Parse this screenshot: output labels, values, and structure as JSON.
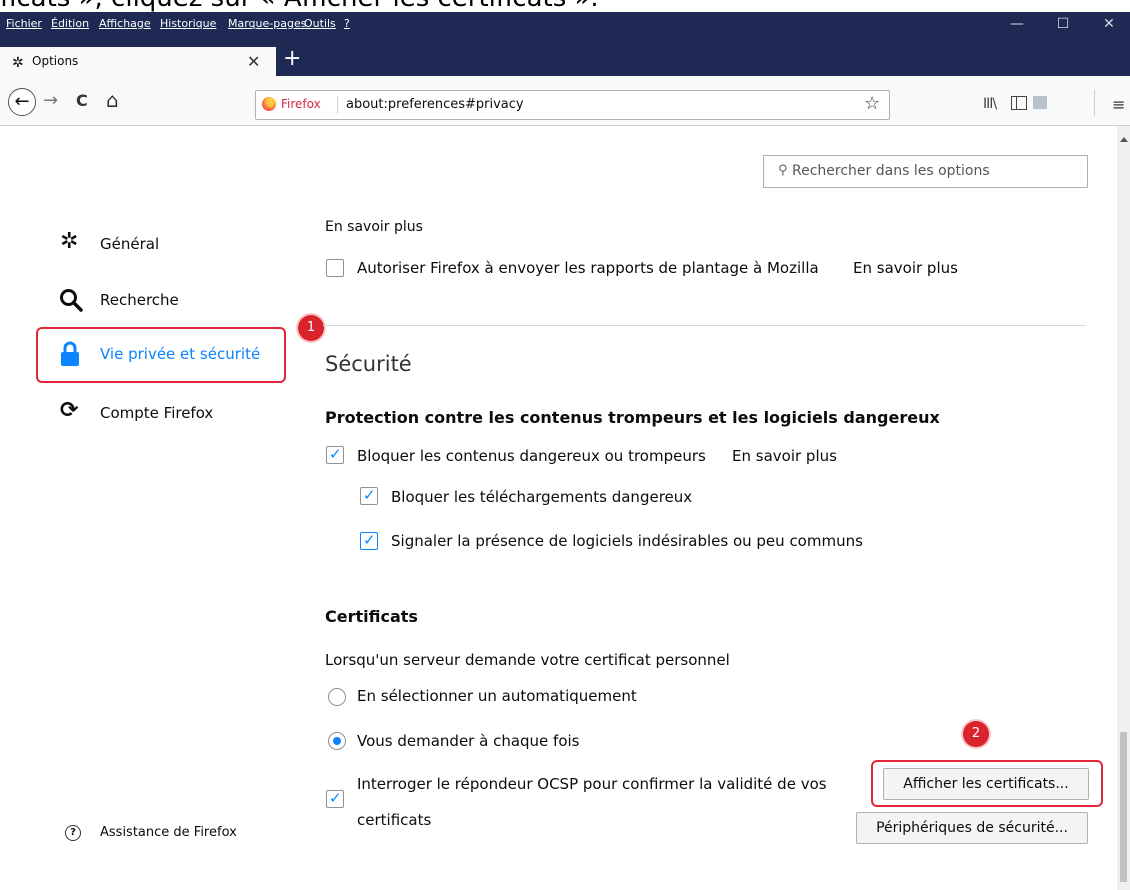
{
  "caption": "ficats », cliquez sur « Afficher les certificats ».",
  "menubar": {
    "items": [
      "Fichier",
      "Édition",
      "Affichage",
      "Historique",
      "Marque-pages",
      "Outils",
      "?"
    ],
    "minimize": "—",
    "maximize": "☐",
    "close": "✕"
  },
  "tab": {
    "title": "Options",
    "close": "✕",
    "new_tab": "+"
  },
  "navbar": {
    "back": "←",
    "forward": "→",
    "reload": "C",
    "home": "⌂",
    "brand": "Firefox",
    "url": "about:preferences#privacy",
    "star": "☆",
    "library": "III\\",
    "menu": "≡"
  },
  "search": {
    "placeholder": "Rechercher dans les options",
    "icon": "search-icon"
  },
  "sidebar": {
    "items": [
      {
        "label": "Général",
        "icon": "gear-icon"
      },
      {
        "label": "Recherche",
        "icon": "search-icon"
      },
      {
        "label": "Vie privée et sécurité",
        "icon": "lock-icon",
        "active": true
      },
      {
        "label": "Compte Firefox",
        "icon": "sync-icon"
      }
    ],
    "support": "Assistance de Firefox"
  },
  "badges": {
    "first": "1",
    "second": "2"
  },
  "content": {
    "top_link": "En savoir plus",
    "crash_reports": {
      "label": "Autoriser Firefox à envoyer les rapports de plantage à Mozilla",
      "link": "En savoir plus",
      "checked": false
    },
    "security_heading": "Sécurité",
    "protection_heading": "Protection contre les contenus trompeurs et les logiciels dangereux",
    "block_dangerous": {
      "label": "Bloquer les contenus dangereux ou trompeurs",
      "link": "En savoir plus",
      "checked": true
    },
    "block_downloads": {
      "label": "Bloquer les téléchargements dangereux",
      "checked": true
    },
    "warn_unwanted": {
      "label": "Signaler la présence de logiciels indésirables ou peu communs",
      "checked": true
    },
    "certificates_heading": "Certificats",
    "cert_question": "Lorsqu'un serveur demande votre certificat personnel",
    "select_auto": {
      "label": "En sélectionner un automatiquement",
      "selected": false
    },
    "ask_every_time": {
      "label": "Vous demander à chaque fois",
      "selected": true
    },
    "ocsp": {
      "line1": "Interroger le répondeur OCSP pour confirmer la validité de vos",
      "line2": "certificats",
      "checked": true
    },
    "view_certificates_button": "Afficher les certificats...",
    "security_devices_button": "Périphériques de sécurité..."
  }
}
